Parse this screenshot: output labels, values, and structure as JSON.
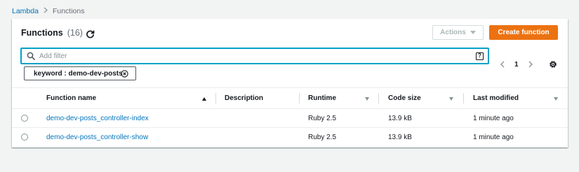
{
  "breadcrumb": {
    "items": [
      {
        "label": "Lambda"
      },
      {
        "label": "Functions"
      }
    ]
  },
  "header": {
    "title": "Functions",
    "count": "(16)",
    "actions_label": "Actions",
    "create_label": "Create function"
  },
  "filter": {
    "placeholder": "Add filter",
    "help_glyph": "?",
    "token": "keyword : demo-dev-posts"
  },
  "pagination": {
    "current_page": "1"
  },
  "table": {
    "columns": [
      {
        "label": "Function name"
      },
      {
        "label": "Description"
      },
      {
        "label": "Runtime"
      },
      {
        "label": "Code size"
      },
      {
        "label": "Last modified"
      }
    ],
    "rows": [
      {
        "name": "demo-dev-posts_controller-index",
        "description": "",
        "runtime": "Ruby 2.5",
        "code_size": "13.9 kB",
        "last_modified": "1 minute ago"
      },
      {
        "name": "demo-dev-posts_controller-show",
        "description": "",
        "runtime": "Ruby 2.5",
        "code_size": "13.9 kB",
        "last_modified": "1 minute ago"
      }
    ]
  },
  "colors": {
    "accent_orange": "#ec7211",
    "link_blue": "#0073bb",
    "focus_blue": "#00a1c9",
    "page_bg": "#f2f3f3"
  },
  "icons": {
    "refresh": "refresh-icon",
    "search": "search-icon",
    "help": "help-icon",
    "dismiss": "dismiss-icon",
    "prev": "chevron-left-icon",
    "next": "chevron-right-icon",
    "settings": "gear-icon"
  }
}
